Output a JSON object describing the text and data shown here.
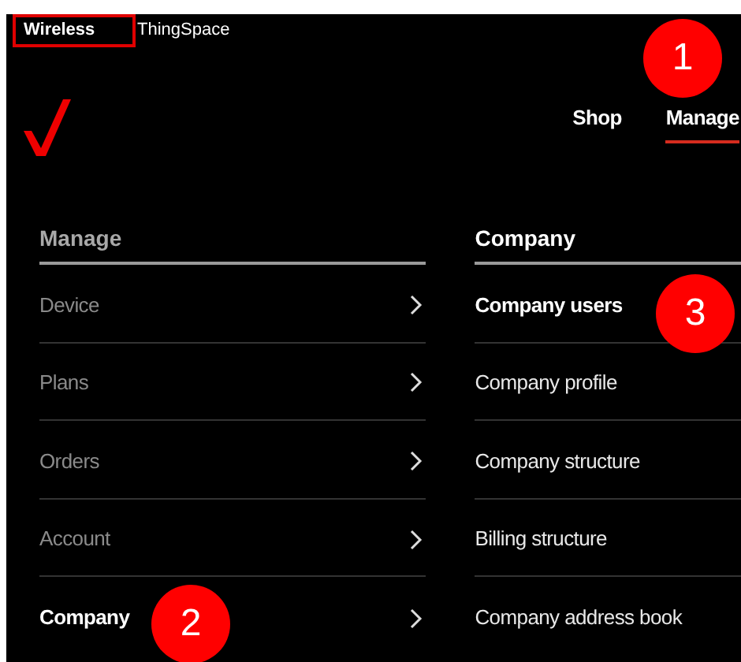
{
  "top_links": [
    {
      "label": "Wireless",
      "selected": true
    },
    {
      "label": "ThingSpace",
      "selected": false
    }
  ],
  "nav": [
    {
      "label": "Shop",
      "selected": false
    },
    {
      "label": "Manage",
      "selected": true
    }
  ],
  "menu": {
    "heading": "Manage",
    "items": [
      {
        "label": "Device",
        "selected": false
      },
      {
        "label": "Plans",
        "selected": false
      },
      {
        "label": "Orders",
        "selected": false
      },
      {
        "label": "Account",
        "selected": false
      },
      {
        "label": "Company",
        "selected": true
      }
    ]
  },
  "submenu": {
    "heading": "Company",
    "items": [
      {
        "label": "Company users",
        "selected": true
      },
      {
        "label": "Company profile",
        "selected": false
      },
      {
        "label": "Company structure",
        "selected": false
      },
      {
        "label": "Billing structure",
        "selected": false
      },
      {
        "label": "Company address book",
        "selected": false
      }
    ]
  },
  "callouts": [
    {
      "number": "1"
    },
    {
      "number": "2"
    },
    {
      "number": "3"
    }
  ]
}
